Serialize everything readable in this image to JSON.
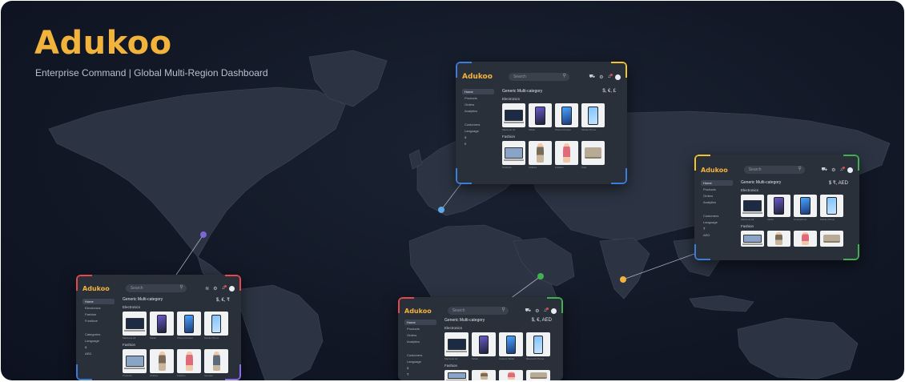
{
  "brand": {
    "name": "Adukoo",
    "tagline": "Enterprise Command | Global Multi-Region Dashboard"
  },
  "colors": {
    "brand": "#f2b33d",
    "blue": "#3b7ddd",
    "yellow": "#f2c230",
    "green": "#3fb24f",
    "red": "#e5484d"
  },
  "panels": [
    {
      "id": "europe",
      "logo": "Adukoo",
      "search": "Search",
      "icons": [
        "cart-icon",
        "settings-icon",
        "bell-icon",
        "profile-icon"
      ],
      "nav": [
        "Home",
        "Products",
        "Orders",
        "Analytics",
        "Customers",
        "Language"
      ],
      "currency_values": [
        "$",
        "€"
      ],
      "page_title": "Generic Multi-category",
      "currency": "$, €, £",
      "sections": [
        {
          "title": "Electronics",
          "items": [
            "Macbook Air",
            "Tablet",
            "Phone Product",
            "Mobile Phone"
          ]
        },
        {
          "title": "Fashion",
          "items": [
            "Products",
            "Clothes",
            "Fashion",
            "Sofa"
          ]
        }
      ]
    },
    {
      "id": "asia",
      "logo": "Adukoo",
      "search": "Search",
      "icons": [
        "cart-icon",
        "settings-icon",
        "bell-icon",
        "profile-icon"
      ],
      "nav": [
        "Home",
        "Products",
        "Orders",
        "Analytics",
        "Customers",
        "Language"
      ],
      "currency_values": [
        "₹",
        "AED"
      ],
      "page_title": "Generic Multi-category",
      "currency": "$ ₹, AED",
      "sections": [
        {
          "title": "Electronics",
          "items": [
            "Macbook Air",
            "Tablet",
            "Smartphone",
            "Mobile Phone"
          ]
        },
        {
          "title": "Fashion",
          "items": [
            "Laptop",
            "Clothes",
            "Fashion",
            "Sofa"
          ]
        }
      ]
    },
    {
      "id": "americas",
      "logo": "Adukoo",
      "search": "Search",
      "icons": [
        "wifi-icon",
        "settings-icon",
        "bell-icon",
        "profile-icon"
      ],
      "nav": [
        "Home",
        "Electronics",
        "Fashion",
        "Furniture",
        "Categories",
        "Language"
      ],
      "currency_values": [
        "$",
        "AED"
      ],
      "page_title": "Generic Multi-category",
      "currency": "$, €, ₹",
      "sections": [
        {
          "title": "Electronics",
          "items": [
            "Macbook Air",
            "Tablet",
            "Phone Product",
            "Mobile Phone"
          ]
        },
        {
          "title": "Fashion",
          "items": [
            "Products",
            "Clothes",
            "Fashion",
            "Sweater"
          ]
        }
      ]
    },
    {
      "id": "middle-east",
      "logo": "Adukoo",
      "search": "Search",
      "icons": [
        "cart-icon",
        "settings-icon",
        "bell-icon",
        "profile-icon"
      ],
      "nav": [
        "Home",
        "Products",
        "Orders",
        "Analytics",
        "Customers",
        "Language"
      ],
      "currency_values": [
        "$",
        "₹"
      ],
      "page_title": "Generic Multi-category",
      "currency": "$, €, AED",
      "sections": [
        {
          "title": "Electronics",
          "items": [
            "Macbook Air",
            "Tablet",
            "Custom Tablet",
            "Bluetooth Phone"
          ]
        },
        {
          "title": "Fashion",
          "items": [
            "Laptop",
            "Clothes",
            "Fashion",
            "Sofa"
          ]
        }
      ]
    }
  ]
}
